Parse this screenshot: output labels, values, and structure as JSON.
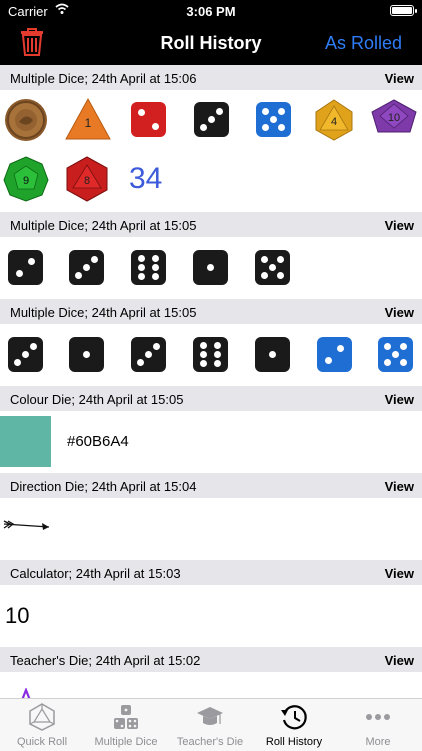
{
  "status": {
    "carrier": "Carrier",
    "time": "3:06 PM"
  },
  "header": {
    "title": "Roll History",
    "action": "As Rolled"
  },
  "entries": [
    {
      "label": "Multiple Dice; 24th April at 15:06",
      "view": "View",
      "total": "34",
      "d4": "1",
      "d8": "4",
      "d10": "10",
      "d12": "9",
      "d20": "8"
    },
    {
      "label": "Multiple Dice; 24th April at 15:05",
      "view": "View"
    },
    {
      "label": "Multiple Dice; 24th April at 15:05",
      "view": "View"
    },
    {
      "label": "Colour Die; 24th April at 15:05",
      "view": "View",
      "value": "#60B6A4",
      "swatch": "#60B6A4"
    },
    {
      "label": "Direction Die; 24th April at 15:04",
      "view": "View"
    },
    {
      "label": "Calculator; 24th April at 15:03",
      "view": "View",
      "value": "10"
    },
    {
      "label": "Teacher's Die; 24th April at 15:02",
      "view": "View"
    }
  ],
  "tabs": [
    {
      "label": "Quick Roll",
      "icon": "d20-icon"
    },
    {
      "label": "Multiple Dice",
      "icon": "dice-icon"
    },
    {
      "label": "Teacher's Die",
      "icon": "graduation-cap-icon"
    },
    {
      "label": "Roll History",
      "icon": "history-icon"
    },
    {
      "label": "More",
      "icon": "more-icon"
    }
  ],
  "colors": {
    "accent": "#2F7DF6",
    "trash": "#E53B2F",
    "header": "#000000",
    "section": "#E5E5EA",
    "total": "#3D5BD9"
  }
}
